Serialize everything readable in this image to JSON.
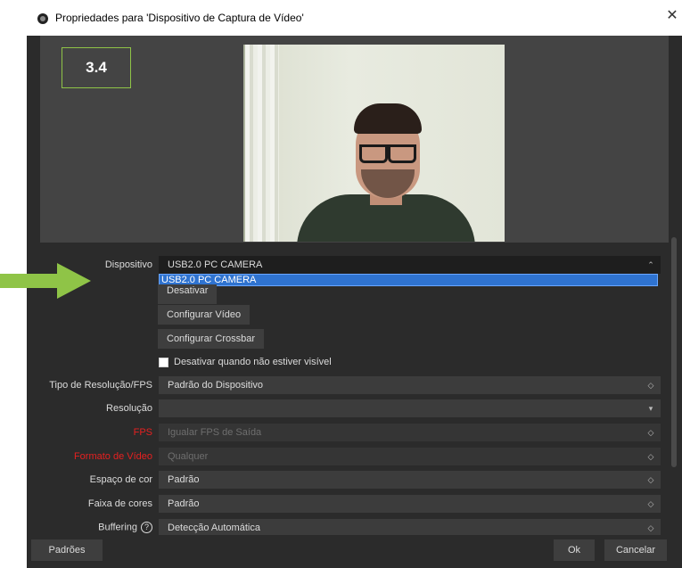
{
  "window": {
    "title": "Propriedades para 'Dispositivo de Captura de Vídeo'",
    "close": "✕"
  },
  "preview": {
    "step_label": "3.4"
  },
  "form": {
    "device_label": "Dispositivo",
    "device_value": "USB2.0 PC CAMERA",
    "dropdown_option": "USB2.0 PC CAMERA",
    "deactivate_button": "Desativar",
    "configure_video_button": "Configurar Vídeo",
    "configure_crossbar_button": "Configurar Crossbar",
    "deactivate_hidden_label": "Desativar quando não estiver visível",
    "deactivate_hidden_checked": false,
    "resolution_type_label": "Tipo de Resolução/FPS",
    "resolution_type_value": "Padrão do Dispositivo",
    "resolution_label": "Resolução",
    "resolution_value": "",
    "fps_label": "FPS",
    "fps_value": "Igualar FPS de Saída",
    "video_format_label": "Formato de Vídeo",
    "video_format_value": "Qualquer",
    "color_space_label": "Espaço de cor",
    "color_space_value": "Padrão",
    "color_range_label": "Faixa de cores",
    "color_range_value": "Padrão",
    "buffering_label": "Buffering",
    "buffering_value": "Detecção Automática"
  },
  "footer": {
    "defaults_button": "Padrões",
    "ok_button": "Ok",
    "cancel_button": "Cancelar"
  },
  "colors": {
    "dialog_bg": "#2b2b2b",
    "highlight": "#2f73d0",
    "error_label": "#e62020",
    "annotation_green": "#8fc447"
  }
}
